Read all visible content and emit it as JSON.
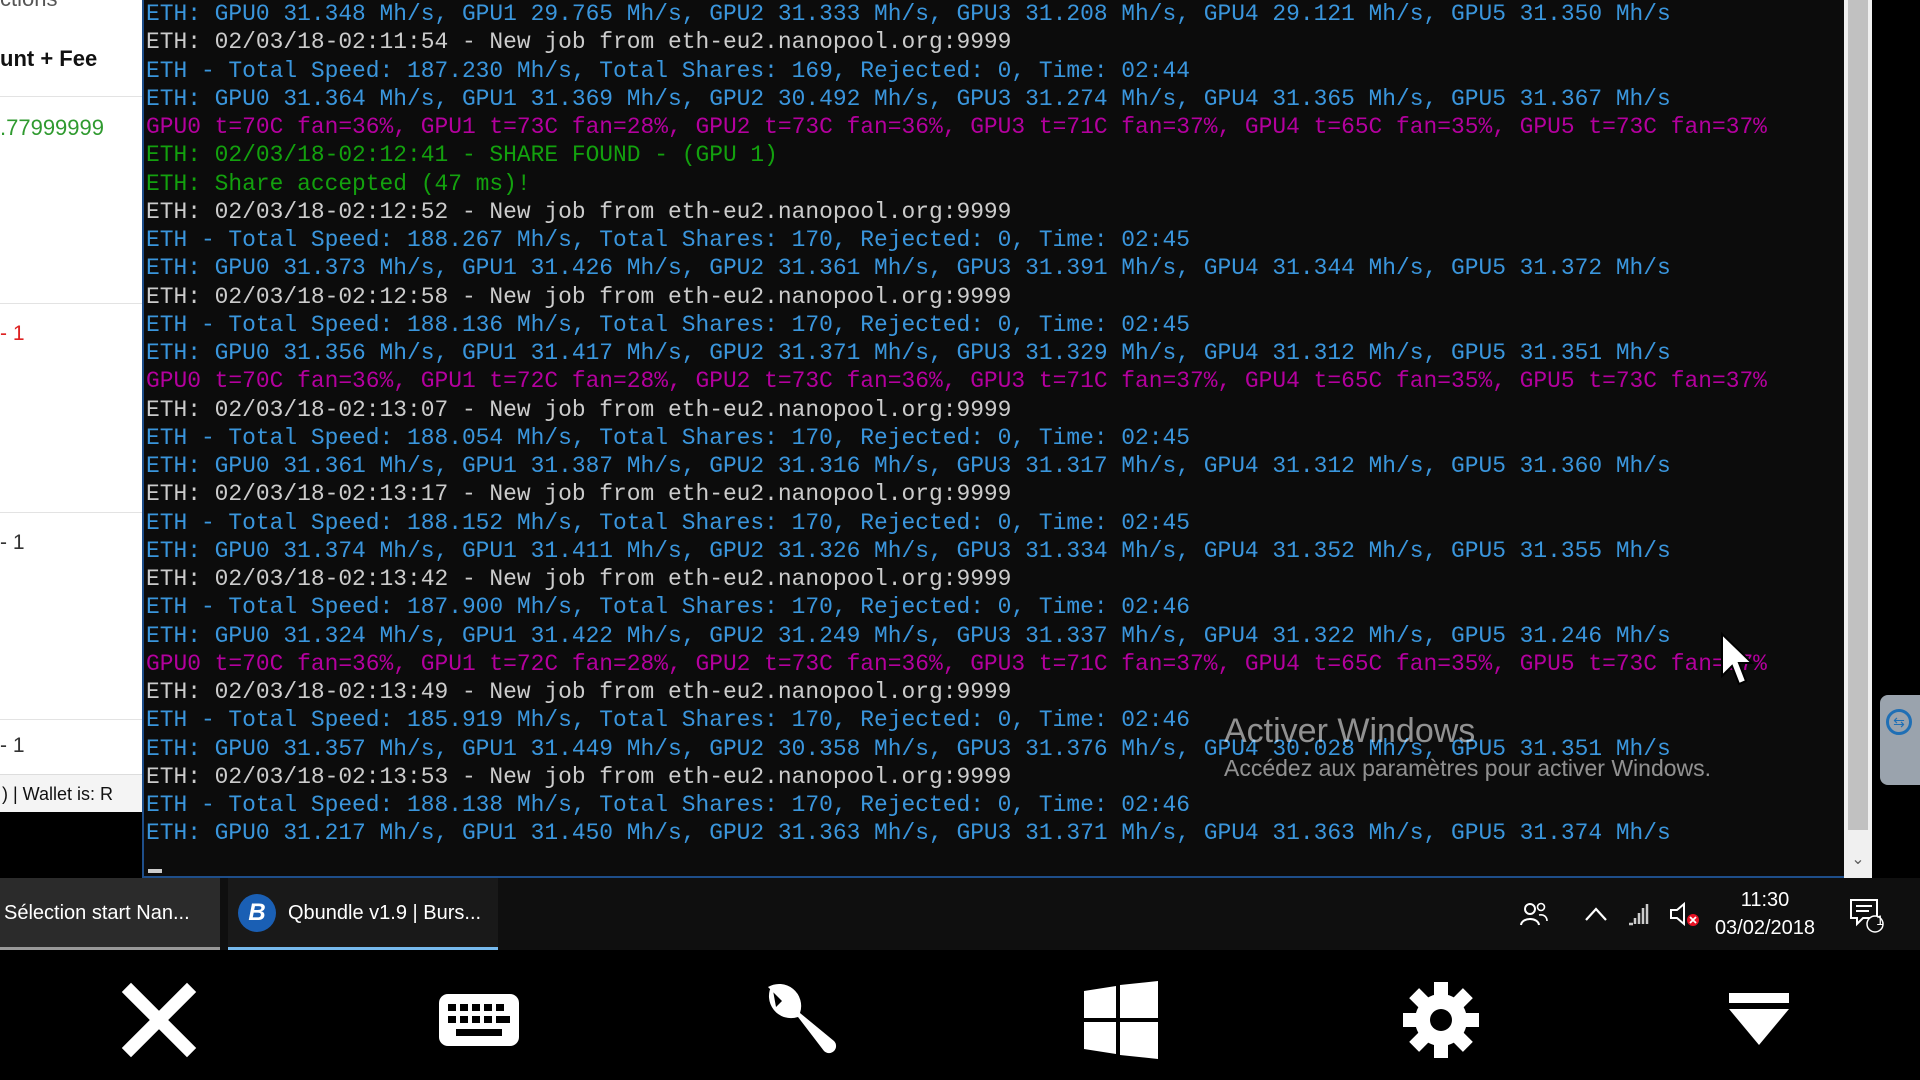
{
  "background_app": {
    "header_partial": "ctions",
    "column_header": "unt + Fee",
    "amount": ".77999999",
    "row1": "- 1",
    "row2": "- 1",
    "row3": "- 1",
    "status_text": ") | Wallet is:  R"
  },
  "console": {
    "lines": [
      {
        "text": "ETH: GPU0 31.348 Mh/s, GPU1 29.765 Mh/s, GPU2 31.333 Mh/s, GPU3 31.208 Mh/s, GPU4 29.121 Mh/s, GPU5 31.350 Mh/s",
        "color": "blue"
      },
      {
        "text": "ETH: 02/03/18-02:11:54 - New job from eth-eu2.nanopool.org:9999",
        "color": "white"
      },
      {
        "text": "ETH - Total Speed: 187.230 Mh/s, Total Shares: 169, Rejected: 0, Time: 02:44",
        "color": "blue"
      },
      {
        "text": "ETH: GPU0 31.364 Mh/s, GPU1 31.369 Mh/s, GPU2 30.492 Mh/s, GPU3 31.274 Mh/s, GPU4 31.365 Mh/s, GPU5 31.367 Mh/s",
        "color": "blue"
      },
      {
        "text": "GPU0 t=70C fan=36%, GPU1 t=73C fan=28%, GPU2 t=73C fan=36%, GPU3 t=71C fan=37%, GPU4 t=65C fan=35%, GPU5 t=73C fan=37%",
        "color": "magenta"
      },
      {
        "text": "ETH: 02/03/18-02:12:41 - SHARE FOUND - (GPU 1)",
        "color": "green"
      },
      {
        "text": "ETH: Share accepted (47 ms)!",
        "color": "green"
      },
      {
        "text": "ETH: 02/03/18-02:12:52 - New job from eth-eu2.nanopool.org:9999",
        "color": "white"
      },
      {
        "text": "ETH - Total Speed: 188.267 Mh/s, Total Shares: 170, Rejected: 0, Time: 02:45",
        "color": "blue"
      },
      {
        "text": "ETH: GPU0 31.373 Mh/s, GPU1 31.426 Mh/s, GPU2 31.361 Mh/s, GPU3 31.391 Mh/s, GPU4 31.344 Mh/s, GPU5 31.372 Mh/s",
        "color": "blue"
      },
      {
        "text": "ETH: 02/03/18-02:12:58 - New job from eth-eu2.nanopool.org:9999",
        "color": "white"
      },
      {
        "text": "ETH - Total Speed: 188.136 Mh/s, Total Shares: 170, Rejected: 0, Time: 02:45",
        "color": "blue"
      },
      {
        "text": "ETH: GPU0 31.356 Mh/s, GPU1 31.417 Mh/s, GPU2 31.371 Mh/s, GPU3 31.329 Mh/s, GPU4 31.312 Mh/s, GPU5 31.351 Mh/s",
        "color": "blue"
      },
      {
        "text": "GPU0 t=70C fan=36%, GPU1 t=72C fan=28%, GPU2 t=73C fan=36%, GPU3 t=71C fan=37%, GPU4 t=65C fan=35%, GPU5 t=73C fan=37%",
        "color": "magenta"
      },
      {
        "text": "ETH: 02/03/18-02:13:07 - New job from eth-eu2.nanopool.org:9999",
        "color": "white"
      },
      {
        "text": "ETH - Total Speed: 188.054 Mh/s, Total Shares: 170, Rejected: 0, Time: 02:45",
        "color": "blue"
      },
      {
        "text": "ETH: GPU0 31.361 Mh/s, GPU1 31.387 Mh/s, GPU2 31.316 Mh/s, GPU3 31.317 Mh/s, GPU4 31.312 Mh/s, GPU5 31.360 Mh/s",
        "color": "blue"
      },
      {
        "text": "ETH: 02/03/18-02:13:17 - New job from eth-eu2.nanopool.org:9999",
        "color": "white"
      },
      {
        "text": "ETH - Total Speed: 188.152 Mh/s, Total Shares: 170, Rejected: 0, Time: 02:45",
        "color": "blue"
      },
      {
        "text": "ETH: GPU0 31.374 Mh/s, GPU1 31.411 Mh/s, GPU2 31.326 Mh/s, GPU3 31.334 Mh/s, GPU4 31.352 Mh/s, GPU5 31.355 Mh/s",
        "color": "blue"
      },
      {
        "text": "ETH: 02/03/18-02:13:42 - New job from eth-eu2.nanopool.org:9999",
        "color": "white"
      },
      {
        "text": "ETH - Total Speed: 187.900 Mh/s, Total Shares: 170, Rejected: 0, Time: 02:46",
        "color": "blue"
      },
      {
        "text": "ETH: GPU0 31.324 Mh/s, GPU1 31.422 Mh/s, GPU2 31.249 Mh/s, GPU3 31.337 Mh/s, GPU4 31.322 Mh/s, GPU5 31.246 Mh/s",
        "color": "blue"
      },
      {
        "text": "GPU0 t=70C fan=36%, GPU1 t=72C fan=28%, GPU2 t=73C fan=36%, GPU3 t=71C fan=37%, GPU4 t=65C fan=35%, GPU5 t=73C fan=37%",
        "color": "magenta"
      },
      {
        "text": "ETH: 02/03/18-02:13:49 - New job from eth-eu2.nanopool.org:9999",
        "color": "white"
      },
      {
        "text": "ETH - Total Speed: 185.919 Mh/s, Total Shares: 170, Rejected: 0, Time: 02:46",
        "color": "blue"
      },
      {
        "text": "ETH: GPU0 31.357 Mh/s, GPU1 31.449 Mh/s, GPU2 30.358 Mh/s, GPU3 31.376 Mh/s, GPU4 30.028 Mh/s, GPU5 31.351 Mh/s",
        "color": "blue"
      },
      {
        "text": "ETH: 02/03/18-02:13:53 - New job from eth-eu2.nanopool.org:9999",
        "color": "white"
      },
      {
        "text": "ETH - Total Speed: 188.138 Mh/s, Total Shares: 170, Rejected: 0, Time: 02:46",
        "color": "blue"
      },
      {
        "text": "ETH: GPU0 31.217 Mh/s, GPU1 31.450 Mh/s, GPU2 31.363 Mh/s, GPU3 31.371 Mh/s, GPU4 31.363 Mh/s, GPU5 31.374 Mh/s",
        "color": "blue"
      }
    ]
  },
  "watermark": {
    "title": "Activer Windows",
    "subtitle": "Accédez aux paramètres pour activer Windows."
  },
  "taskbar": {
    "item1_label": "Sélection start Nan...",
    "item2_label": "Qbundle v1.9 | Burs...",
    "item2_logo_letter": "B",
    "time": "11:30",
    "date": "03/02/2018",
    "notification_count": "1"
  },
  "icons": {
    "people": "people-icon",
    "chevron_up": "chevron-up-icon",
    "network": "network-icon",
    "volume_muted": "volume-muted-icon",
    "action_center": "action-center-icon",
    "close": "close-icon",
    "keyboard": "keyboard-icon",
    "wrench": "wrench-icon",
    "windows": "windows-icon",
    "gear": "gear-icon",
    "collapse": "collapse-down-icon"
  },
  "colors": {
    "console_bg": "#0c0c0c",
    "console_white": "#cccccc",
    "console_blue": "#3a96dd",
    "console_magenta": "#b4009e",
    "console_green": "#13a10e",
    "amount_green": "#2f9a2f",
    "negative_red": "#dd2222"
  }
}
